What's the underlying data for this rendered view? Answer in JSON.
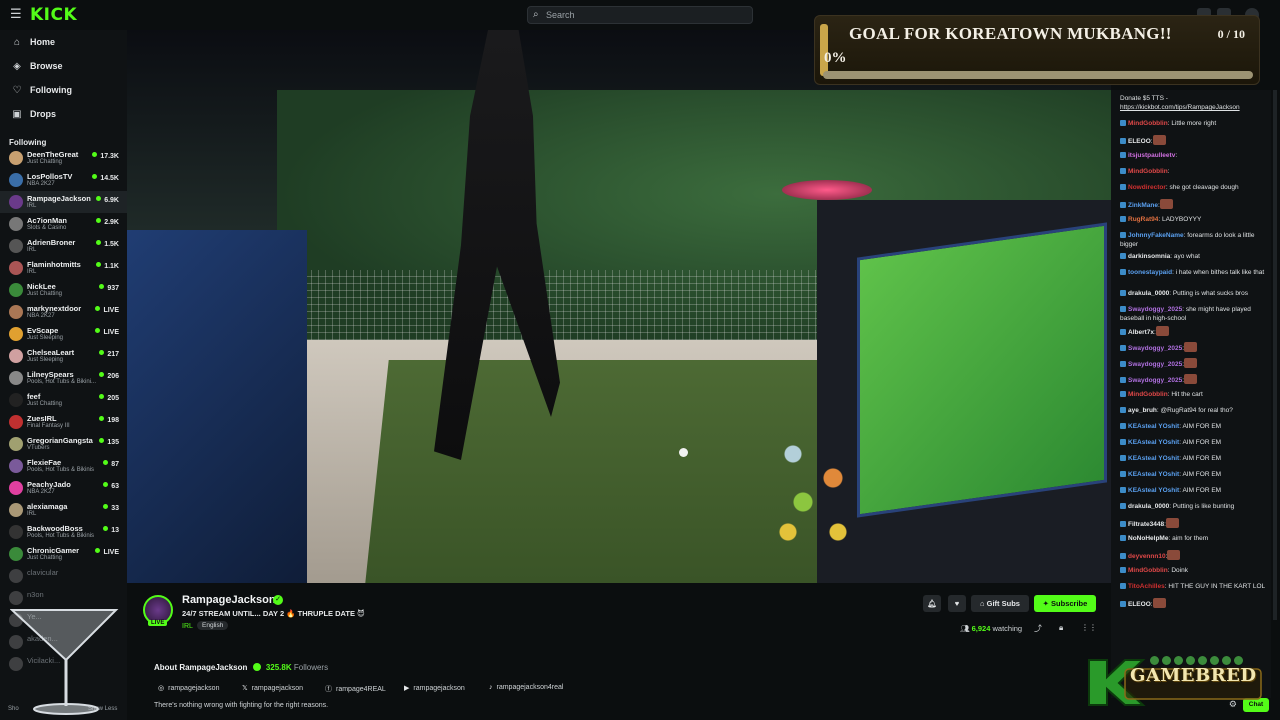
{
  "topbar": {
    "logo": "KICK",
    "search_placeholder": "Search"
  },
  "nav": [
    {
      "label": "Home",
      "icon": "home-icon"
    },
    {
      "label": "Browse",
      "icon": "compass-icon"
    },
    {
      "label": "Following",
      "icon": "heart-icon"
    },
    {
      "label": "Drops",
      "icon": "drop-icon"
    }
  ],
  "following": {
    "title": "Following",
    "channels": [
      {
        "name": "DeenTheGreat",
        "category": "Just Chatting",
        "viewers": "17.3K",
        "color": "#c8a070"
      },
      {
        "name": "LosPollosTV",
        "category": "NBA 2K27",
        "viewers": "14.5K",
        "color": "#3a6ea8"
      },
      {
        "name": "RampageJackson",
        "category": "IRL",
        "viewers": "6.9K",
        "color": "#6a3a8a"
      },
      {
        "name": "Ac7ionMan",
        "category": "Slots & Casino",
        "viewers": "2.9K",
        "color": "#777777"
      },
      {
        "name": "AdrienBroner",
        "category": "IRL",
        "viewers": "1.5K",
        "color": "#555555"
      },
      {
        "name": "Flaminhotmitts",
        "category": "IRL",
        "viewers": "1.1K",
        "color": "#aa5555"
      },
      {
        "name": "NickLee",
        "category": "Just Chatting",
        "viewers": "937",
        "color": "#3a8a3a"
      },
      {
        "name": "markynextdoor",
        "category": "NBA 2K27",
        "viewers": "LIVE",
        "color": "#aa7755"
      },
      {
        "name": "EvScape",
        "category": "Just Sleeping",
        "viewers": "LIVE",
        "color": "#e0a030"
      },
      {
        "name": "ChelseaLeart",
        "category": "Just Sleeping",
        "viewers": "217",
        "color": "#d0a0a0"
      },
      {
        "name": "LilneySpears",
        "category": "Pools, Hot Tubs & Bikini...",
        "viewers": "206",
        "color": "#888888"
      },
      {
        "name": "feef",
        "category": "Just Chatting",
        "viewers": "205",
        "color": "#222222"
      },
      {
        "name": "ZuesIRL",
        "category": "Final Fantasy III",
        "viewers": "198",
        "color": "#c03030"
      },
      {
        "name": "GregorianGangsta",
        "category": "VTubers",
        "viewers": "135",
        "color": "#a0a070"
      },
      {
        "name": "FlexieFae",
        "category": "Pools, Hot Tubs & Bikinis",
        "viewers": "87",
        "color": "#7a5a9a"
      },
      {
        "name": "PeachyJado",
        "category": "NBA 2K27",
        "viewers": "63",
        "color": "#e040a0"
      },
      {
        "name": "alexiamaga",
        "category": "IRL",
        "viewers": "33",
        "color": "#aa9977"
      },
      {
        "name": "BackwoodBoss",
        "category": "Pools, Hot Tubs & Bikinis",
        "viewers": "13",
        "color": "#333333"
      },
      {
        "name": "ChronicGamer",
        "category": "Just Chatting",
        "viewers": "LIVE",
        "color": "#3a8a3a"
      },
      {
        "name": "clavicular",
        "category": "",
        "viewers": "",
        "color": "#777777",
        "offline": true
      },
      {
        "name": "n3on",
        "category": "",
        "viewers": "",
        "color": "#777777",
        "offline": true
      },
      {
        "name": "Ye...",
        "category": "",
        "viewers": "",
        "color": "#777777",
        "offline": true
      },
      {
        "name": "akaden...",
        "category": "",
        "viewers": "",
        "color": "#777777",
        "offline": true
      },
      {
        "name": "Vicilacki...",
        "category": "",
        "viewers": "",
        "color": "#777777",
        "offline": true
      }
    ],
    "show_less": "Show Less",
    "show_prefix": "Sho"
  },
  "goal": {
    "title": "GOAL FOR KOREATOWN MUKBANG!!",
    "count": "0 / 10",
    "percent_label": "0%",
    "progress": 0.0,
    "accent": "#caa64a"
  },
  "chat": {
    "donate_text": "Donate $5 TTS - ",
    "donate_link": "https://kickbot.com/tips/RampageJackson",
    "messages": [
      {
        "user": "MindGobblin",
        "text": ": Little more right",
        "color": "#e04848"
      },
      {
        "user": "ELEOO",
        "text": ":",
        "color": "#e6e8ea",
        "emote": true
      },
      {
        "user": "itsjustpaulleetv",
        "text": ":",
        "color": "#d070e0"
      },
      {
        "user": "MindGobblin",
        "text": ":",
        "color": "#e04848"
      },
      {
        "user": "Nowdirector",
        "text": ": she got cleavage dough",
        "color": "#d03030"
      },
      {
        "user": "ZinkMane",
        "text": ":",
        "color": "#5aa0f0",
        "emote": true
      },
      {
        "user": "RugRat94",
        "text": ": LADYBOYYY",
        "color": "#e07040"
      },
      {
        "user": "JohnnyFakeName",
        "text": ": forearms do look a little bigger",
        "color": "#5aa0f0"
      },
      {
        "user": "darkinsomnia",
        "text": ": ayo what",
        "color": "#e6e8ea"
      },
      {
        "user": "toonestaypaid",
        "text": ": i hate when bithes talk like that",
        "color": "#5aa0f0"
      },
      {
        "user": "drakula_0000",
        "text": ": Putting is what sucks bros",
        "color": "#e6e8ea"
      },
      {
        "user": "Swaydoggy_2025",
        "text": ": she might have played baseball in high-school",
        "color": "#b070e0"
      },
      {
        "user": "Albert7x",
        "text": ":",
        "color": "#e6e8ea",
        "emote": true
      },
      {
        "user": "Swaydoggy_2025",
        "text": ":",
        "color": "#b070e0",
        "emote": true
      },
      {
        "user": "Swaydoggy_2025",
        "text": ":",
        "color": "#b070e0",
        "emote": true
      },
      {
        "user": "Swaydoggy_2025",
        "text": ":",
        "color": "#b070e0",
        "emote": true
      },
      {
        "user": "MindGobblin",
        "text": ": Hit the cart",
        "color": "#e04848"
      },
      {
        "user": "aye_bruh",
        "text": ": @RugRat94 for real tho?",
        "color": "#e6e8ea"
      },
      {
        "user": "KEAsteal YOshit",
        "text": ": AIM FOR EM",
        "color": "#5aa0f0"
      },
      {
        "user": "KEAsteal YOshit",
        "text": ": AIM FOR EM",
        "color": "#5aa0f0"
      },
      {
        "user": "KEAsteal YOshit",
        "text": ": AIM FOR EM",
        "color": "#5aa0f0"
      },
      {
        "user": "KEAsteal YOshit",
        "text": ": AIM FOR EM",
        "color": "#5aa0f0"
      },
      {
        "user": "KEAsteal YOshit",
        "text": ": AIM FOR EM",
        "color": "#5aa0f0"
      },
      {
        "user": "drakula_0000",
        "text": ": Putting is like bunting",
        "color": "#e6e8ea"
      },
      {
        "user": "Filtrate3448",
        "text": ":",
        "color": "#e6e8ea",
        "emote": true
      },
      {
        "user": "NoNoHelpMe",
        "text": ": aim for them",
        "color": "#e6e8ea"
      },
      {
        "user": "deyvennn10",
        "text": ":",
        "color": "#e04848",
        "emote": true
      },
      {
        "user": "MindGobblin",
        "text": ": Doink",
        "color": "#e04848"
      },
      {
        "user": "TitoAchilles",
        "text": ": HIT THE GUY IN THE KART LOL",
        "color": "#d03030"
      },
      {
        "user": "ELEOO",
        "text": ":",
        "color": "#e6e8ea",
        "emote": true
      }
    ],
    "send_label": "Chat"
  },
  "channel": {
    "name": "RampageJackson",
    "title": "24/7 STREAM UNTIL... DAY 2 🔥 THRUPLE DATE 😈",
    "category": "IRL",
    "language": "English",
    "live_label": "LIVE",
    "gift_label": "Gift Subs",
    "subscribe_label": "Subscribe",
    "watching_count": "6,924",
    "watching_label": "watching",
    "about_prefix": "About ",
    "followers_count": "325.8K",
    "followers_label": "Followers",
    "socials": [
      {
        "icon": "instagram-icon",
        "glyph": "◎",
        "handle": "rampagejackson"
      },
      {
        "icon": "x-icon",
        "glyph": "𝕏",
        "handle": "rampagejackson"
      },
      {
        "icon": "facebook-icon",
        "glyph": "ⓕ",
        "handle": "rampage4REAL"
      },
      {
        "icon": "youtube-icon",
        "glyph": "▶",
        "handle": "rampagejackson"
      },
      {
        "icon": "tiktok-icon",
        "glyph": "♪",
        "handle": "rampagejackson4real"
      }
    ],
    "bio": "There's nothing wrong with fighting for the right reasons."
  },
  "overlay": {
    "gamebred_text": "GAMEBRED"
  },
  "colors": {
    "accent": "#53fc18",
    "background": "#0b0e0f",
    "sidebar": "#0f1214"
  }
}
